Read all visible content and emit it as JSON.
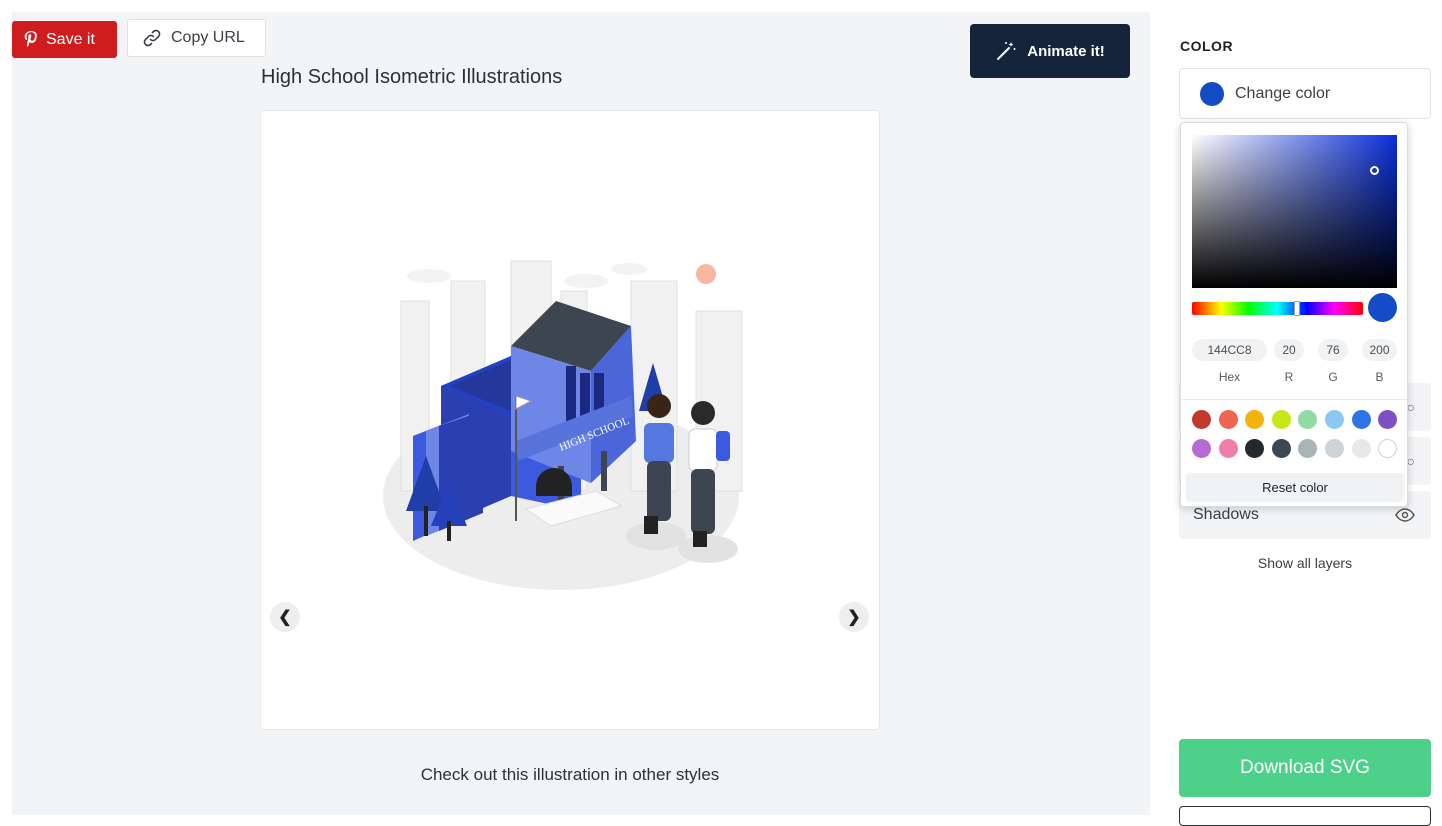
{
  "toolbar": {
    "save_label": "Save it",
    "copy_label": "Copy URL",
    "animate_label": "Animate it!"
  },
  "illustration": {
    "title": "High School Isometric Illustrations",
    "sign_text": "HIGH SCHOOL"
  },
  "other_styles_text": "Check out this illustration in other styles",
  "sidebar": {
    "color_heading": "COLOR",
    "change_color_label": "Change color",
    "current_color": "#144cc8",
    "layers": [
      {
        "label": ""
      },
      {
        "label": ""
      },
      {
        "label": "Shadows"
      }
    ],
    "show_all_layers": "Show all layers",
    "download_label": "Download SVG"
  },
  "color_picker": {
    "hex": "144CC8",
    "r": "20",
    "g": "76",
    "b": "200",
    "hex_label": "Hex",
    "r_label": "R",
    "g_label": "G",
    "b_label": "B",
    "reset_label": "Reset color",
    "swatches_row1": [
      "#c0392b",
      "#f0654f",
      "#f5b20e",
      "#c6e81a",
      "#8fdca3",
      "#8cc8f4",
      "#2f74e5",
      "#7e4fc4"
    ],
    "swatches_row2": [
      "#b46bd6",
      "#f07fae",
      "#24292e",
      "#3c4852",
      "#a9b3ba",
      "#cdd3d8",
      "#e6e9ec",
      "#ffffff"
    ]
  },
  "colors": {
    "pinterest_red": "#cf1d1f",
    "animate_navy": "#15243a",
    "download_green": "#4dd08a",
    "accent_blue": "#144cc8"
  }
}
